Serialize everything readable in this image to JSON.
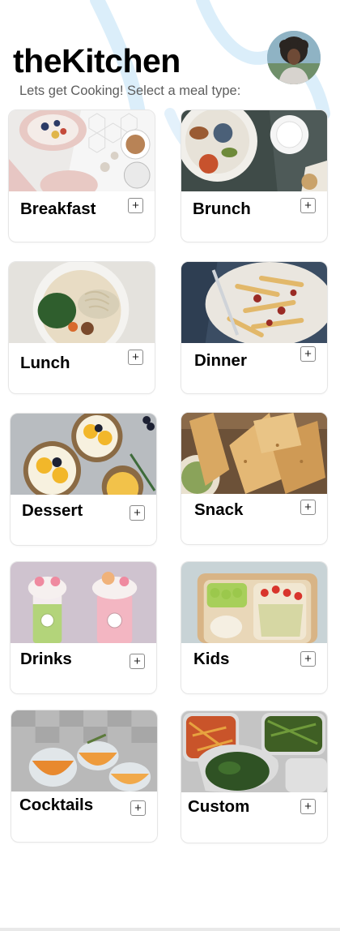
{
  "header": {
    "title": "theKitchen",
    "subtitle": "Lets get Cooking! Select a meal type:"
  },
  "meals": [
    {
      "label": "Breakfast",
      "add": "+"
    },
    {
      "label": "Brunch",
      "add": "+"
    },
    {
      "label": "Lunch",
      "add": "+"
    },
    {
      "label": "Dinner",
      "add": "+"
    },
    {
      "label": "Dessert",
      "add": "+"
    },
    {
      "label": "Snack",
      "add": "+"
    },
    {
      "label": "Drinks",
      "add": "+"
    },
    {
      "label": "Kids",
      "add": "+"
    },
    {
      "label": "Cocktails",
      "add": "+"
    },
    {
      "label": "Custom",
      "add": "+"
    }
  ],
  "colors": {
    "background": "#ffffff",
    "title": "#000000",
    "subtitle": "#5d5d5d",
    "decorative_swirl": "#cfe6f7"
  }
}
